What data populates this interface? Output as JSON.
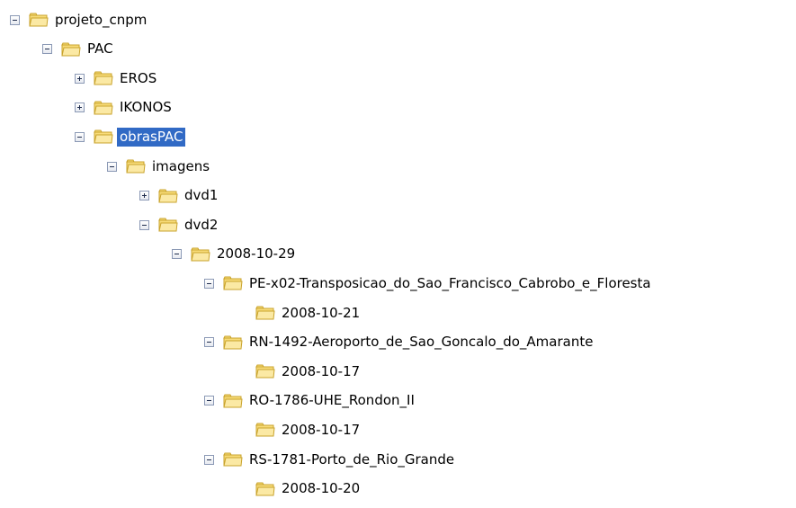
{
  "tree": {
    "nodes": [
      {
        "label": "projeto_cnpm",
        "level": 0,
        "expander": "minus",
        "selected": false
      },
      {
        "label": "PAC",
        "level": 1,
        "expander": "minus",
        "selected": false
      },
      {
        "label": "EROS",
        "level": 2,
        "expander": "plus",
        "selected": false
      },
      {
        "label": "IKONOS",
        "level": 2,
        "expander": "plus",
        "selected": false
      },
      {
        "label": "obrasPAC",
        "level": 2,
        "expander": "minus",
        "selected": true
      },
      {
        "label": "imagens",
        "level": 3,
        "expander": "minus",
        "selected": false
      },
      {
        "label": "dvd1",
        "level": 4,
        "expander": "plus",
        "selected": false
      },
      {
        "label": "dvd2",
        "level": 4,
        "expander": "minus",
        "selected": false
      },
      {
        "label": "2008-10-29",
        "level": 5,
        "expander": "minus",
        "selected": false
      },
      {
        "label": "PE-x02-Transposicao_do_Sao_Francisco_Cabrobo_e_Floresta",
        "level": 6,
        "expander": "minus",
        "selected": false
      },
      {
        "label": "2008-10-21",
        "level": 7,
        "expander": "none",
        "selected": false
      },
      {
        "label": "RN-1492-Aeroporto_de_Sao_Goncalo_do_Amarante",
        "level": 6,
        "expander": "minus",
        "selected": false
      },
      {
        "label": "2008-10-17",
        "level": 7,
        "expander": "none",
        "selected": false
      },
      {
        "label": "RO-1786-UHE_Rondon_II",
        "level": 6,
        "expander": "minus",
        "selected": false
      },
      {
        "label": "2008-10-17",
        "level": 7,
        "expander": "none",
        "selected": false
      },
      {
        "label": "RS-1781-Porto_de_Rio_Grande",
        "level": 6,
        "expander": "minus",
        "selected": false
      },
      {
        "label": "2008-10-20",
        "level": 7,
        "expander": "none",
        "selected": false
      }
    ]
  },
  "colors": {
    "selection_bg": "#316ac5",
    "selection_text": "#ffffff",
    "folder_fill": "#f8dc7a",
    "folder_outline": "#c9a32c"
  },
  "icons": {
    "folder": "folder-icon",
    "expand": "expand-plus-icon",
    "collapse": "collapse-minus-icon"
  }
}
